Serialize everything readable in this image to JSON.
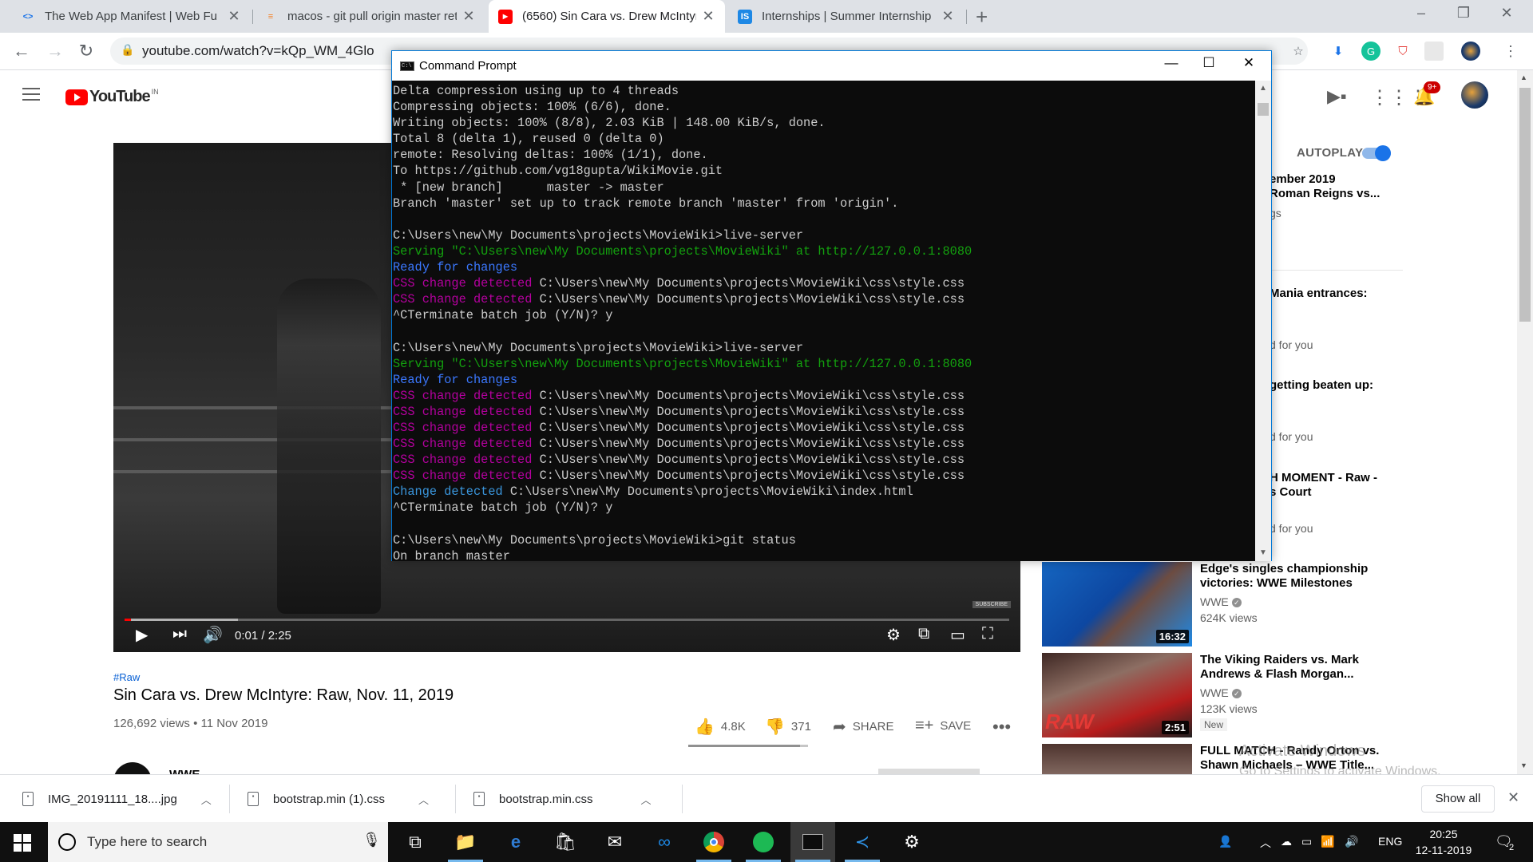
{
  "browser": {
    "tabs": [
      {
        "title": "The Web App Manifest  |  Web Fu",
        "favicon": "devtools-icon",
        "active": false
      },
      {
        "title": "macos - git pull origin master ret",
        "favicon": "stackoverflow-icon",
        "active": false
      },
      {
        "title": "(6560) Sin Cara vs. Drew McIntyre",
        "favicon": "youtube-icon",
        "active": true
      },
      {
        "title": "Internships | Summer Internship",
        "favicon": "internshala-icon",
        "active": false
      }
    ],
    "url": "youtube.com/watch?v=kQp_WM_4Glo"
  },
  "youtube": {
    "logo_text": "YouTube",
    "country": "IN",
    "notification_count": "9+",
    "video": {
      "current_time": "0:01",
      "duration": "2:25",
      "time_display": "0:01 / 2:25",
      "subscribe_watermark": "SUBSCRIBE",
      "progress_fraction": 0.007,
      "buffered_fraction": 0.128
    },
    "hashtag": "#Raw",
    "title": "Sin Cara vs. Drew McIntyre: Raw, Nov. 11, 2019",
    "meta": "126,692 views • 11 Nov 2019",
    "actions": {
      "likes": "4.8K",
      "dislikes": "371",
      "share": "SHARE",
      "save": "SAVE",
      "like_ratio": 0.93
    },
    "channel": "WWE",
    "autoplay_label": "AUTOPLAY",
    "partial_recs": [
      {
        "line1": "ember 2019",
        "line2": "Roman Reigns vs...",
        "line3": "gs"
      },
      {
        "line1": "Mania entrances:",
        "line2": "",
        "line3": "d for you"
      },
      {
        "line1": " getting beaten up:",
        "line2": "",
        "line3": "d for you"
      },
      {
        "line1": "H MOMENT - Raw -",
        "line2": "s Court",
        "line3": "d for you"
      }
    ],
    "recommendations": [
      {
        "title": "Edge's singles championship victories: WWE Milestones",
        "channel": "WWE",
        "views": "624K views",
        "duration": "16:32",
        "badge": ""
      },
      {
        "title": "The Viking Raiders vs. Mark Andrews & Flash Morgan...",
        "channel": "WWE",
        "views": "123K views",
        "duration": "2:51",
        "badge": "New"
      },
      {
        "title": "FULL MATCH - Randy Orton vs. Shawn Michaels – WWE Title...",
        "channel": "",
        "views": "",
        "duration": "",
        "badge": ""
      }
    ]
  },
  "cmd": {
    "title": "Command Prompt",
    "lines": [
      [
        {
          "t": "Delta compression using up to 4 threads",
          "c": ""
        }
      ],
      [
        {
          "t": "Compressing objects: 100% (6/6), done.",
          "c": ""
        }
      ],
      [
        {
          "t": "Writing objects: 100% (8/8), 2.03 KiB | 148.00 KiB/s, done.",
          "c": ""
        }
      ],
      [
        {
          "t": "Total 8 (delta 1), reused 0 (delta 0)",
          "c": ""
        }
      ],
      [
        {
          "t": "remote: Resolving deltas: 100% (1/1), done.",
          "c": ""
        }
      ],
      [
        {
          "t": "To https://github.com/vg18gupta/WikiMovie.git",
          "c": ""
        }
      ],
      [
        {
          "t": " * [new branch]      master -> master",
          "c": ""
        }
      ],
      [
        {
          "t": "Branch 'master' set up to track remote branch 'master' from 'origin'.",
          "c": ""
        }
      ],
      [
        {
          "t": "",
          "c": ""
        }
      ],
      [
        {
          "t": "C:\\Users\\new\\My Documents\\projects\\MovieWiki>live-server",
          "c": ""
        }
      ],
      [
        {
          "t": "Serving \"C:\\Users\\new\\My Documents\\projects\\MovieWiki\" at http://127.0.0.1:8080",
          "c": "green"
        }
      ],
      [
        {
          "t": "Ready for changes",
          "c": "blue"
        }
      ],
      [
        {
          "t": "CSS change detected",
          "c": "magenta"
        },
        {
          "t": " C:\\Users\\new\\My Documents\\projects\\MovieWiki\\css\\style.css",
          "c": ""
        }
      ],
      [
        {
          "t": "CSS change detected",
          "c": "magenta"
        },
        {
          "t": " C:\\Users\\new\\My Documents\\projects\\MovieWiki\\css\\style.css",
          "c": ""
        }
      ],
      [
        {
          "t": "^CTerminate batch job (Y/N)? y",
          "c": ""
        }
      ],
      [
        {
          "t": "",
          "c": ""
        }
      ],
      [
        {
          "t": "C:\\Users\\new\\My Documents\\projects\\MovieWiki>live-server",
          "c": ""
        }
      ],
      [
        {
          "t": "Serving \"C:\\Users\\new\\My Documents\\projects\\MovieWiki\" at http://127.0.0.1:8080",
          "c": "green"
        }
      ],
      [
        {
          "t": "Ready for changes",
          "c": "blue"
        }
      ],
      [
        {
          "t": "CSS change detected",
          "c": "magenta"
        },
        {
          "t": " C:\\Users\\new\\My Documents\\projects\\MovieWiki\\css\\style.css",
          "c": ""
        }
      ],
      [
        {
          "t": "CSS change detected",
          "c": "magenta"
        },
        {
          "t": " C:\\Users\\new\\My Documents\\projects\\MovieWiki\\css\\style.css",
          "c": ""
        }
      ],
      [
        {
          "t": "CSS change detected",
          "c": "magenta"
        },
        {
          "t": " C:\\Users\\new\\My Documents\\projects\\MovieWiki\\css\\style.css",
          "c": ""
        }
      ],
      [
        {
          "t": "CSS change detected",
          "c": "magenta"
        },
        {
          "t": " C:\\Users\\new\\My Documents\\projects\\MovieWiki\\css\\style.css",
          "c": ""
        }
      ],
      [
        {
          "t": "CSS change detected",
          "c": "magenta"
        },
        {
          "t": " C:\\Users\\new\\My Documents\\projects\\MovieWiki\\css\\style.css",
          "c": ""
        }
      ],
      [
        {
          "t": "CSS change detected",
          "c": "magenta"
        },
        {
          "t": " C:\\Users\\new\\My Documents\\projects\\MovieWiki\\css\\style.css",
          "c": ""
        }
      ],
      [
        {
          "t": "Change detected",
          "c": "cyan"
        },
        {
          "t": " C:\\Users\\new\\My Documents\\projects\\MovieWiki\\index.html",
          "c": ""
        }
      ],
      [
        {
          "t": "^CTerminate batch job (Y/N)? y",
          "c": ""
        }
      ],
      [
        {
          "t": "",
          "c": ""
        }
      ],
      [
        {
          "t": "C:\\Users\\new\\My Documents\\projects\\MovieWiki>git status",
          "c": ""
        }
      ],
      [
        {
          "t": "On branch master",
          "c": ""
        }
      ]
    ]
  },
  "downloads": {
    "items": [
      {
        "name": "IMG_20191111_18....jpg"
      },
      {
        "name": "bootstrap.min (1).css"
      },
      {
        "name": "bootstrap.min.css"
      }
    ],
    "show_all": "Show all"
  },
  "watermark": {
    "line1": "Activate Windows",
    "line2": "Go to Settings to activate Windows."
  },
  "taskbar": {
    "search_placeholder": "Type here to search",
    "language": "ENG",
    "time": "20:25",
    "date": "12-11-2019",
    "notification_count": "2"
  },
  "colors": {
    "youtube_red": "#ff0000",
    "cmd_green": "#13a10e",
    "cmd_blue": "#3b78ff",
    "cmd_magenta": "#b4009e",
    "cmd_cyan": "#3a96dd",
    "link_blue": "#065fd4"
  }
}
